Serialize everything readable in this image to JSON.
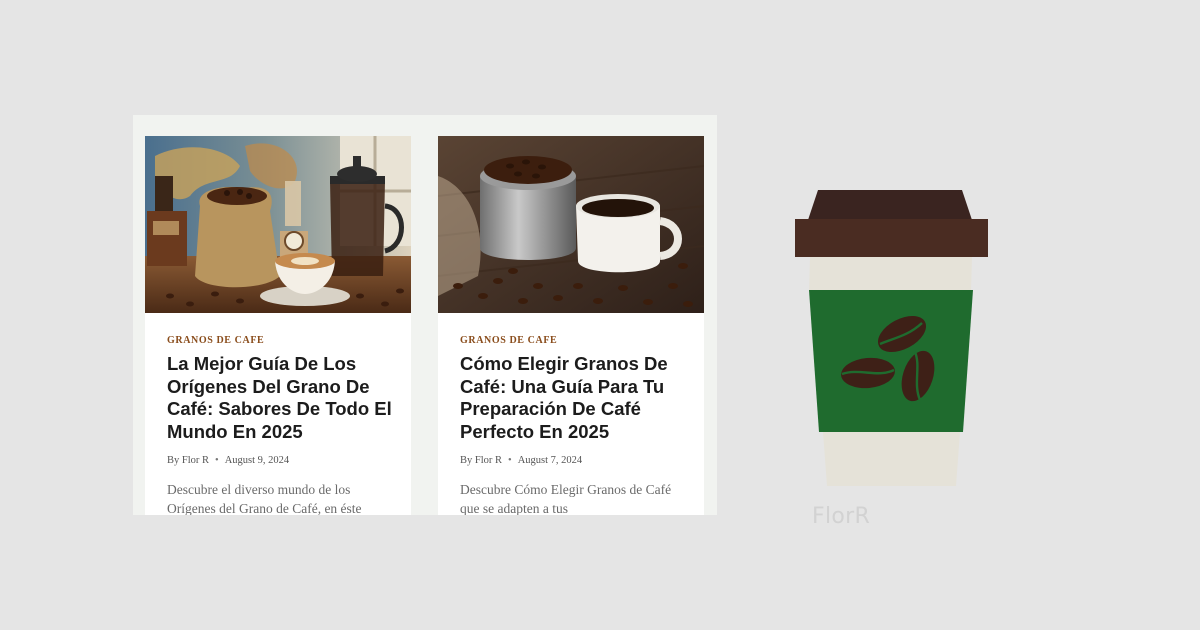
{
  "cards": [
    {
      "category": "GRANOS DE CAFE",
      "title": "La Mejor Guía De Los Orígenes Del Grano De Café: Sabores De Todo El Mundo En 2025",
      "author": "By Flor R",
      "separator": "•",
      "date": "August 9, 2024",
      "excerpt": "Descubre el diverso mundo de los Orígenes del Grano de Café, en éste"
    },
    {
      "category": "GRANOS DE CAFE",
      "title": "Cómo Elegir Granos De Café: Una Guía Para Tu Preparación De Café Perfecto En 2025",
      "author": "By Flor R",
      "separator": "•",
      "date": "August 7, 2024",
      "excerpt": "Descubre Cómo Elegir Granos de Café que se adapten a tus"
    }
  ],
  "brand": "FlorR",
  "colors": {
    "page_bg": "#e5e5e5",
    "panel_bg": "#f1f3f0",
    "category": "#8a4d1c",
    "cup_lid": "#3a2420",
    "cup_sleeve": "#1f6b2e",
    "cup_body": "#e5e2d8"
  },
  "icons": [
    "world-map-coffee-photo",
    "coffee-tin-photo",
    "coffee-cup-logo-icon",
    "coffee-bean-icon"
  ]
}
